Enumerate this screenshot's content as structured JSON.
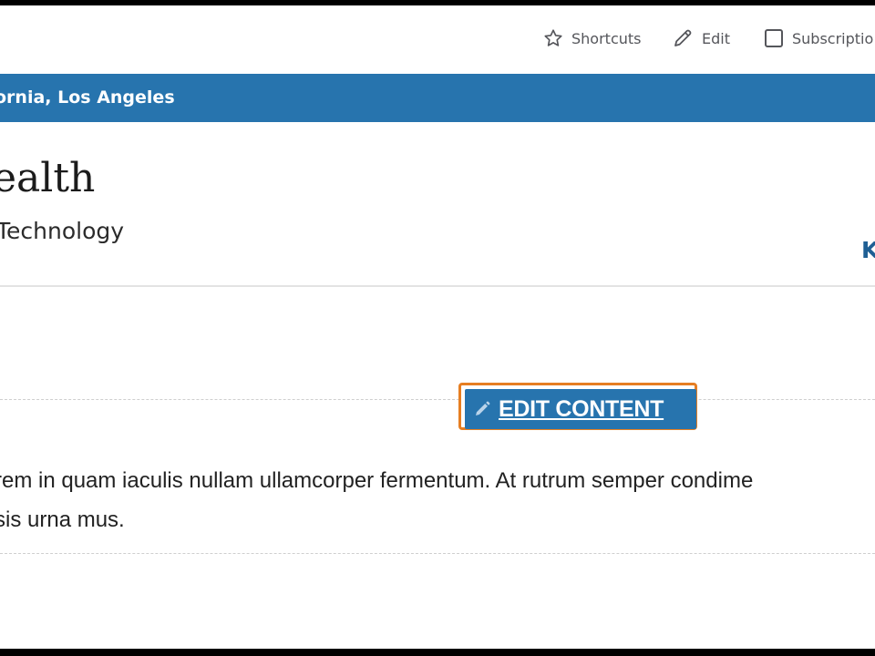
{
  "toolbar": {
    "shortcuts": {
      "label": "Shortcuts",
      "icon": "star-icon"
    },
    "edit": {
      "label": "Edit",
      "icon": "pencil-icon"
    },
    "subscriptions": {
      "label": "Subscriptio",
      "icon": "checkbox-icon"
    }
  },
  "sitebar": {
    "name": "ornia, Los Angeles"
  },
  "header": {
    "title": "ealth",
    "subtitle": "Technology",
    "nav_partial": "K"
  },
  "content": {
    "edit_button": {
      "label": "EDIT CONTENT",
      "icon": "pencil-icon"
    },
    "body_lines": [
      "rem in quam iaculis nullam ullamcorper fermentum. At rutrum semper condime",
      "sis urna mus."
    ]
  },
  "colors": {
    "brand_blue": "#2774ae",
    "focus_outline": "#e67e22",
    "link_blue": "#1f5f94"
  }
}
